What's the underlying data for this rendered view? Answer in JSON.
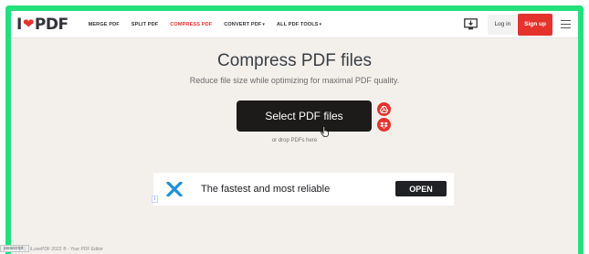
{
  "header": {
    "logo": {
      "pre": "I",
      "heart": "❤",
      "post": "PDF"
    },
    "nav": [
      {
        "label": "MERGE PDF",
        "caret": ""
      },
      {
        "label": "SPLIT PDF",
        "caret": ""
      },
      {
        "label": "COMPRESS PDF",
        "caret": ""
      },
      {
        "label": "CONVERT PDF",
        "caret": "▾"
      },
      {
        "label": "ALL PDF TOOLS",
        "caret": "▾"
      }
    ],
    "login_label": "Log in",
    "signup_label": "Sign up"
  },
  "main": {
    "title": "Compress PDF files",
    "subtitle": "Reduce file size while optimizing for maximal PDF quality.",
    "select_label": "Select PDF files",
    "drop_text": "or drop PDFs here"
  },
  "ad": {
    "text": "The fastest and most reliable",
    "open_label": "OPEN",
    "choices_label": "i"
  },
  "footer": {
    "copyright": "© iLovePDF 2022 ® - Your PDF Editor"
  },
  "status_bar": {
    "text": "javascript:;"
  },
  "colors": {
    "accent": "#e5322d",
    "frame": "#23e07a",
    "dark_button": "#1c1b1a"
  },
  "icons": {
    "desktop": "desktop-download-icon",
    "menu": "hamburger-menu-icon",
    "gdrive": "google-drive-icon",
    "dropbox": "dropbox-icon"
  }
}
